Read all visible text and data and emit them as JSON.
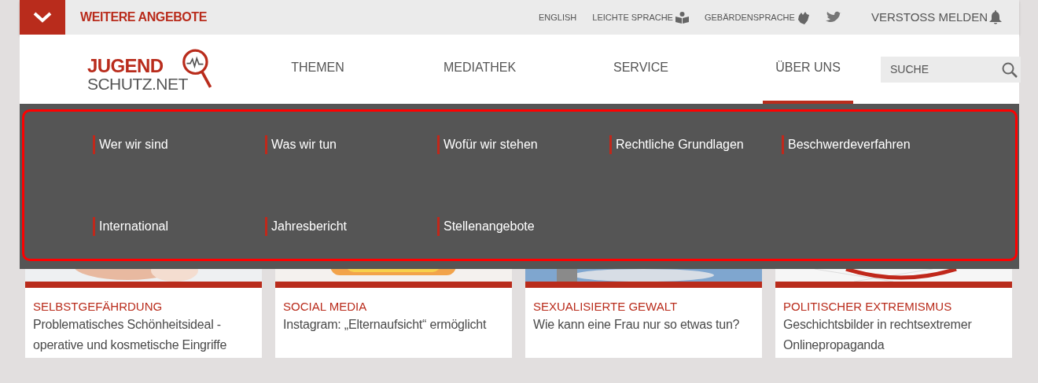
{
  "top_bar": {
    "title": "WEITERE ANGEBOTE",
    "links": [
      {
        "label": "ENGLISH"
      },
      {
        "label": "LEICHTE SPRACHE"
      },
      {
        "label": "GEBÄRDENSPRACHE"
      }
    ],
    "report": "VERSTOSS MELDEN"
  },
  "logo": {
    "line1": "JUGEND",
    "line2": "SCHUTZ.NET"
  },
  "nav": [
    {
      "label": "THEMEN",
      "selected": false
    },
    {
      "label": "MEDIATHEK",
      "selected": false
    },
    {
      "label": "SERVICE",
      "selected": false
    },
    {
      "label": "ÜBER UNS",
      "selected": true
    }
  ],
  "search": {
    "placeholder": "SUCHE"
  },
  "dropdown": [
    {
      "label": "Wer wir sind"
    },
    {
      "label": "Was wir tun"
    },
    {
      "label": "Wofür wir stehen"
    },
    {
      "label": "Rechtliche Grundlagen"
    },
    {
      "label": "Beschwerdeverfahren"
    },
    {
      "label": "International"
    },
    {
      "label": "Jahresbericht"
    },
    {
      "label": "Stellenangebote"
    }
  ],
  "cards": [
    {
      "category": "SELBSTGEFÄHRDUNG",
      "title": "Problematisches Schönheitsideal - operative und kosmetische Eingriffe"
    },
    {
      "category": "SOCIAL MEDIA",
      "title": "Instagram: „Elternaufsicht“ ermöglicht"
    },
    {
      "category": "SEXUALISIERTE GEWALT",
      "title": "Wie kann eine Frau nur so etwas tun?"
    },
    {
      "category": "POLITISCHER EXTREMISMUS",
      "title": "Geschichtsbilder in rechtsextremer Onlinepropaganda"
    }
  ]
}
